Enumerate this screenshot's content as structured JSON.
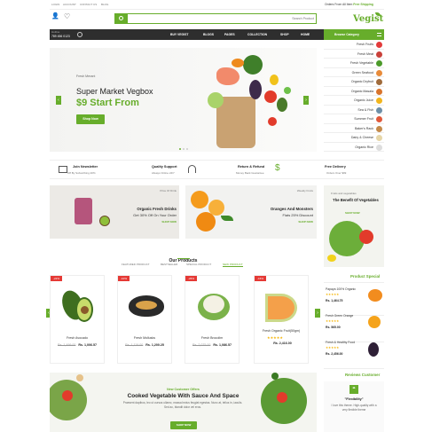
{
  "topbar": {
    "links": [
      "LOGIN",
      "ACCOUNT",
      "CONTACT US",
      "BLOG"
    ],
    "offer": "Orders From All Item",
    "offer_highlight": "Free Shipping"
  },
  "header": {
    "search_placeholder": "Search Product",
    "logo": "Vegist",
    "hotline_label": "Hotline",
    "hotline_number": "789 456 0123"
  },
  "nav": {
    "items": [
      "BUY VEGIST",
      "BLOGS",
      "PAGES",
      "COLLECTION",
      "SHOP",
      "HOME"
    ],
    "browse_label": "Browse Category"
  },
  "categories": [
    "Fresh Fruits",
    "Fresh Meat",
    "Fresh Vegetable",
    "Green Seafood",
    "Organic Dryfruit",
    "Organic Masala",
    "Organic Juice",
    "Sea & Fish",
    "Summer Fruit",
    "Baker's Rack",
    "Dairy & Cheese",
    "Organic Rice"
  ],
  "hero": {
    "small_label": "Fresh Merant",
    "title": "Super Market Vegbox",
    "price": "$9 Start From",
    "button": "Shop Now"
  },
  "services": [
    {
      "title": "Join Newsletter",
      "sub": "Off By Subscribing 20%"
    },
    {
      "title": "Quality Support",
      "sub": "Always Online 24/7"
    },
    {
      "title": "Return & Refund",
      "sub": "Money Back Guarantee"
    },
    {
      "title": "Free Delivery",
      "sub": "Orders Over $99"
    }
  ],
  "banners": [
    {
      "eyebrow": "Price Of Drink",
      "title": "Organic Fresh Drinks",
      "sub": "Get 30% Off On Your Order",
      "cta": "SHOP NOW"
    },
    {
      "eyebrow": "Weekly Fruits",
      "title": "Oranges And Monsters",
      "sub": "Flats 25% Discount",
      "cta": "SHOP NOW"
    }
  ],
  "side_banner": {
    "eyebrow": "Fruits and vegetables",
    "title": "The Benefit Of Vegetables",
    "cta": "SHOP NOW"
  },
  "products_section": {
    "title": "Our Products",
    "tabs": [
      "FEATURED PRODUCT",
      "BESTSELLER",
      "SPECIAL PRODUCT",
      "NEW PRODUCT"
    ],
    "active_tab": 3
  },
  "products": [
    {
      "badge": "-22%",
      "name": "Fresh Avocado",
      "old": "Rs. 1,499.00",
      "price": "Rs. 1,006.57"
    },
    {
      "badge": "-10%",
      "name": "Fresh Mollusks",
      "old": "Rs. 1,119.00",
      "price": "Rs. 1,200.25"
    },
    {
      "badge": "-26%",
      "name": "Fresh Brocolim",
      "old": "Rs. 2,075.00",
      "price": "Rs. 1,086.57"
    },
    {
      "badge": "-16%",
      "name": "Fresh Organic Fruit(50gm)",
      "old": "",
      "price": "Rs. 2,416.00"
    }
  ],
  "special": {
    "title": "Product Special",
    "items": [
      {
        "name": "Papaya 100% Organic",
        "price": "Rs. 1,464.75"
      },
      {
        "name": "Fresh Green Orange",
        "price": "Rs. 565.00"
      },
      {
        "name": "Fresh & Healthy Food",
        "price": "Rs. 2,456.00"
      }
    ]
  },
  "offer_banner": {
    "eyebrow": "New Customer Offers",
    "title": "Cooked Vegetable With Sauce And Space",
    "text": "Praesent dapibus, leo ut cursus ullamc, massa lectus feugiat egestas. Nunc at, tellus in, iaculis. Sed ac, blandit dolor vel eros.",
    "cta": "SHOP NOW"
  },
  "reviews": {
    "title": "Reviews Customer",
    "headline": "\"Flexibility\"",
    "text": "I love this theme. High-quality with a very flexible theme"
  },
  "colors": {
    "accent": "#67ad2b",
    "dark": "#2e2e2e",
    "sale": "#e53935"
  }
}
